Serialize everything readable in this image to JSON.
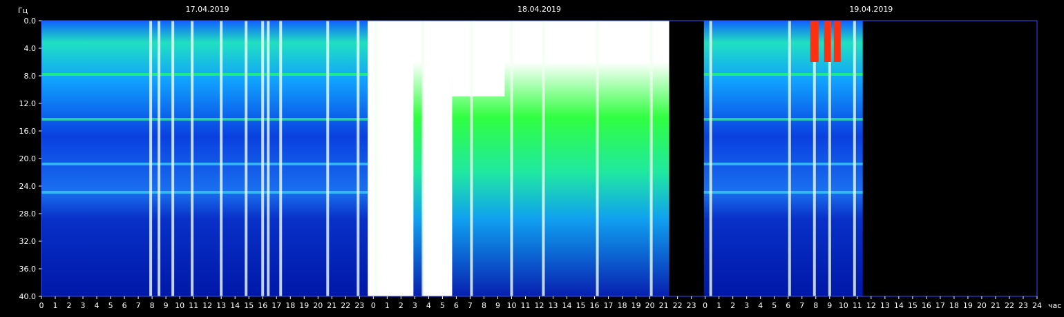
{
  "chart_data": {
    "type": "heatmap",
    "title": "",
    "ylabel": "Гц",
    "xlabel": "час",
    "ylim": [
      0,
      40
    ],
    "y_ticks": [
      "0.0",
      "4.0",
      "8.0",
      "12.0",
      "16.0",
      "20.0",
      "24.0",
      "28.0",
      "32.0",
      "36.0",
      "40.0"
    ],
    "x_ticks": [
      "0",
      "1",
      "2",
      "3",
      "4",
      "5",
      "6",
      "7",
      "8",
      "9",
      "10",
      "11",
      "12",
      "13",
      "14",
      "15",
      "16",
      "17",
      "18",
      "19",
      "20",
      "21",
      "22",
      "23",
      "0",
      "1",
      "2",
      "3",
      "4",
      "5",
      "6",
      "7",
      "8",
      "9",
      "10",
      "11",
      "12",
      "13",
      "14",
      "15",
      "16",
      "17",
      "18",
      "19",
      "20",
      "21",
      "22",
      "23",
      "0",
      "1",
      "2",
      "3",
      "4",
      "5",
      "6",
      "7",
      "8",
      "9",
      "10",
      "11",
      "12",
      "13",
      "14",
      "15",
      "16",
      "17",
      "18",
      "19",
      "20",
      "21",
      "22",
      "23",
      "24"
    ],
    "dates": [
      "17.04.2019",
      "18.04.2019",
      "19.04.2019"
    ],
    "data_gaps_hours": [
      [
        45.4,
        47.9
      ],
      [
        59.4,
        72.0
      ]
    ],
    "bright_bands_hz": [
      7.8,
      14.3,
      20.8,
      24.9
    ],
    "colors": {
      "background": "#000000",
      "low": "#0018b8",
      "mid": "#00e8c8",
      "high": "#20ff30",
      "peak": "#ff3000",
      "saturated": "#ffffff"
    }
  }
}
